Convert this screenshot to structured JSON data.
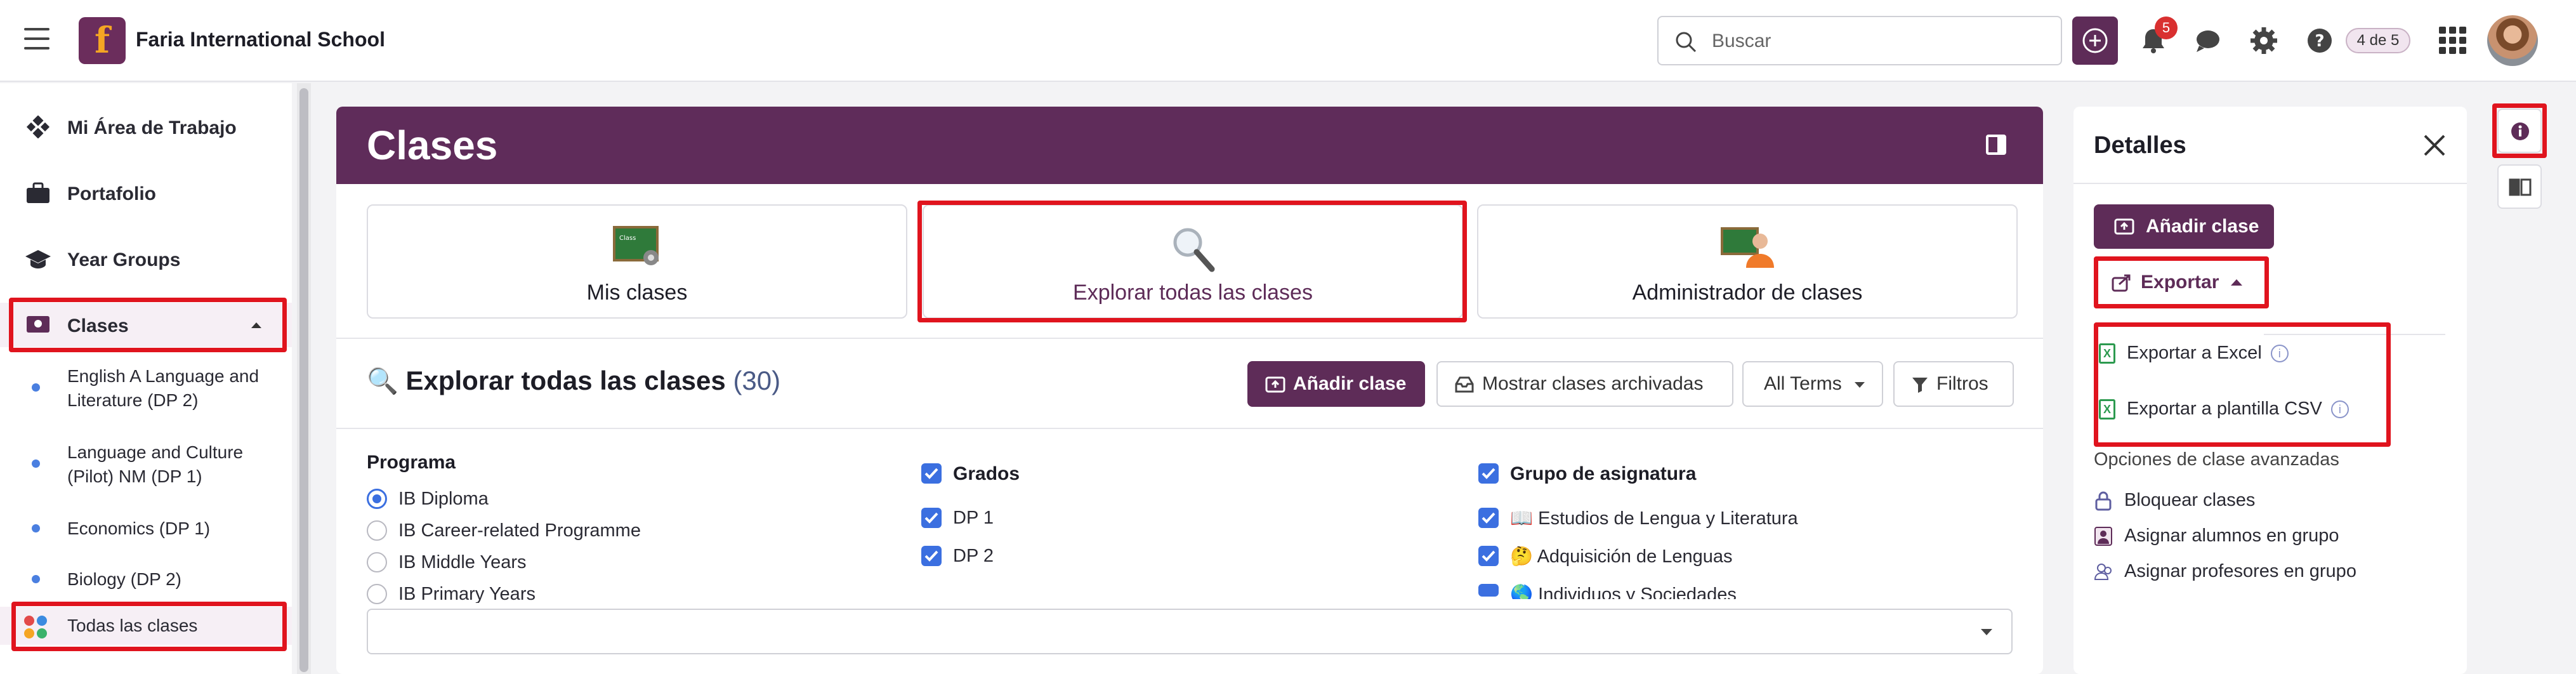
{
  "topbar": {
    "school_name": "Faria International School",
    "logo_letter": "f",
    "search_placeholder": "Buscar",
    "notif_count": "5",
    "page_indicator": "4 de 5"
  },
  "sidebar": {
    "items": [
      {
        "label": "Mi Área de Trabajo",
        "icon": "workspace-icon"
      },
      {
        "label": "Portafolio",
        "icon": "briefcase-icon"
      },
      {
        "label": "Year Groups",
        "icon": "graduation-cap-icon"
      },
      {
        "label": "Clases",
        "icon": "class-icon"
      }
    ],
    "classes": [
      "English A Language and Literature (DP 2)",
      "Language and Culture (Pilot) NM (DP 1)",
      "Economics (DP 1)",
      "Biology (DP 2)"
    ],
    "all_classes": "Todas las clases"
  },
  "main": {
    "title": "Clases",
    "cards": [
      {
        "label": "Mis clases"
      },
      {
        "label": "Explorar todas las clases"
      },
      {
        "label": "Administrador de clases"
      }
    ],
    "section_title": "Explorar todas las clases",
    "section_count": "(30)",
    "buttons": {
      "add": "Añadir clase",
      "archived": "Mostrar clases archivadas",
      "terms": "All Terms",
      "filters": "Filtros"
    },
    "filters": {
      "programa_label": "Programa",
      "programs": [
        "IB Diploma",
        "IB Career-related Programme",
        "IB Middle Years",
        "IB Primary Years"
      ],
      "grados_label": "Grados",
      "grades": [
        "DP 1",
        "DP 2"
      ],
      "grupo_label": "Grupo de asignatura",
      "groups": [
        "📖 Estudios de Lengua y Literatura",
        "🤔 Adquisición de Lenguas",
        "🌎 Individuos y Sociedades"
      ]
    }
  },
  "details": {
    "title": "Detalles",
    "add_button": "Añadir clase",
    "export_button": "Exportar",
    "export_options": [
      "Exportar a Excel",
      "Exportar a plantilla CSV"
    ],
    "advanced_title": "Opciones de clase avanzadas",
    "advanced_options": [
      "Bloquear clases",
      "Asignar alumnos en grupo",
      "Asignar profesores en grupo"
    ]
  },
  "colors": {
    "brand": "#5e2c58",
    "highlight": "#e0141e",
    "accent": "#3b6fe0"
  }
}
